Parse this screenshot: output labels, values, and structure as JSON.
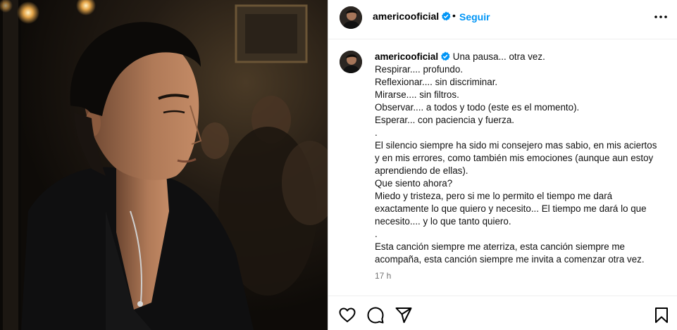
{
  "post": {
    "username": "americooficial",
    "follow_label": "Seguir",
    "header_separator": "•",
    "caption_first_line": "Una pausa... otra vez.",
    "caption_lines": [
      "Respirar.... profundo.",
      "Reflexionar.... sin discriminar.",
      "Mirarse.... sin filtros.",
      "Observar.... a todos y todo (este es el momento).",
      "Esperar... con paciencia y fuerza.",
      ".",
      "El silencio siempre ha sido mi consejero mas sabio, en mis aciertos y en mis errores, como también mis emociones (aunque aun estoy aprendiendo de ellas).",
      "Que siento ahora?",
      "Miedo y tristeza, pero si me lo permito el tiempo me dará exactamente lo que quiero y necesito... El tiempo me dará lo que necesito.... y lo que tanto quiero.",
      ".",
      "Esta canción siempre me aterriza, esta canción siempre me acompaña, esta canción siempre me invita a comenzar otra vez."
    ],
    "timestamp": "17 h"
  },
  "icons": {
    "more": "more-options-icon",
    "verified": "verified-badge-icon",
    "like": "heart-icon",
    "comment": "comment-icon",
    "share": "share-icon",
    "save": "bookmark-icon"
  },
  "colors": {
    "follow_blue": "#0095f6",
    "verified_blue": "#0095f6",
    "timestamp_gray": "#737373",
    "photo_background": "#14110d"
  }
}
